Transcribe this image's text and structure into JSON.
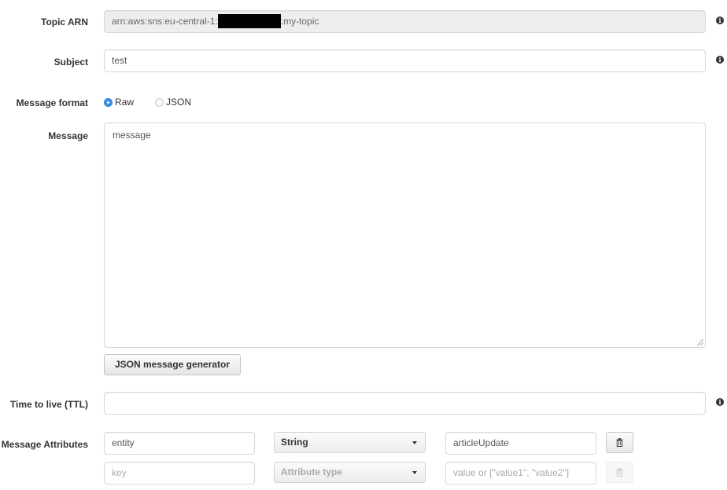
{
  "form": {
    "topic_arn": {
      "label": "Topic ARN",
      "value_prefix": "arn:aws:sns:eu-central-1:",
      "value_suffix": ":my-topic"
    },
    "subject": {
      "label": "Subject",
      "value": "test"
    },
    "message_format": {
      "label": "Message format",
      "options": [
        {
          "label": "Raw",
          "selected": true
        },
        {
          "label": "JSON",
          "selected": false
        }
      ]
    },
    "message": {
      "label": "Message",
      "value": "message"
    },
    "json_generator_button": "JSON message generator",
    "ttl": {
      "label": "Time to live (TTL)",
      "value": ""
    },
    "message_attributes": {
      "label": "Message Attributes",
      "rows": [
        {
          "key": "entity",
          "type": "String",
          "value": "articleUpdate"
        }
      ],
      "new_row": {
        "key_placeholder": "key",
        "type_placeholder": "Attribute type",
        "value_placeholder": "value or [\"value1\", \"value2\"]"
      }
    }
  },
  "icons": {
    "info": "info-circle-icon",
    "delete": "trash-icon",
    "dropdown": "caret-down-icon"
  }
}
